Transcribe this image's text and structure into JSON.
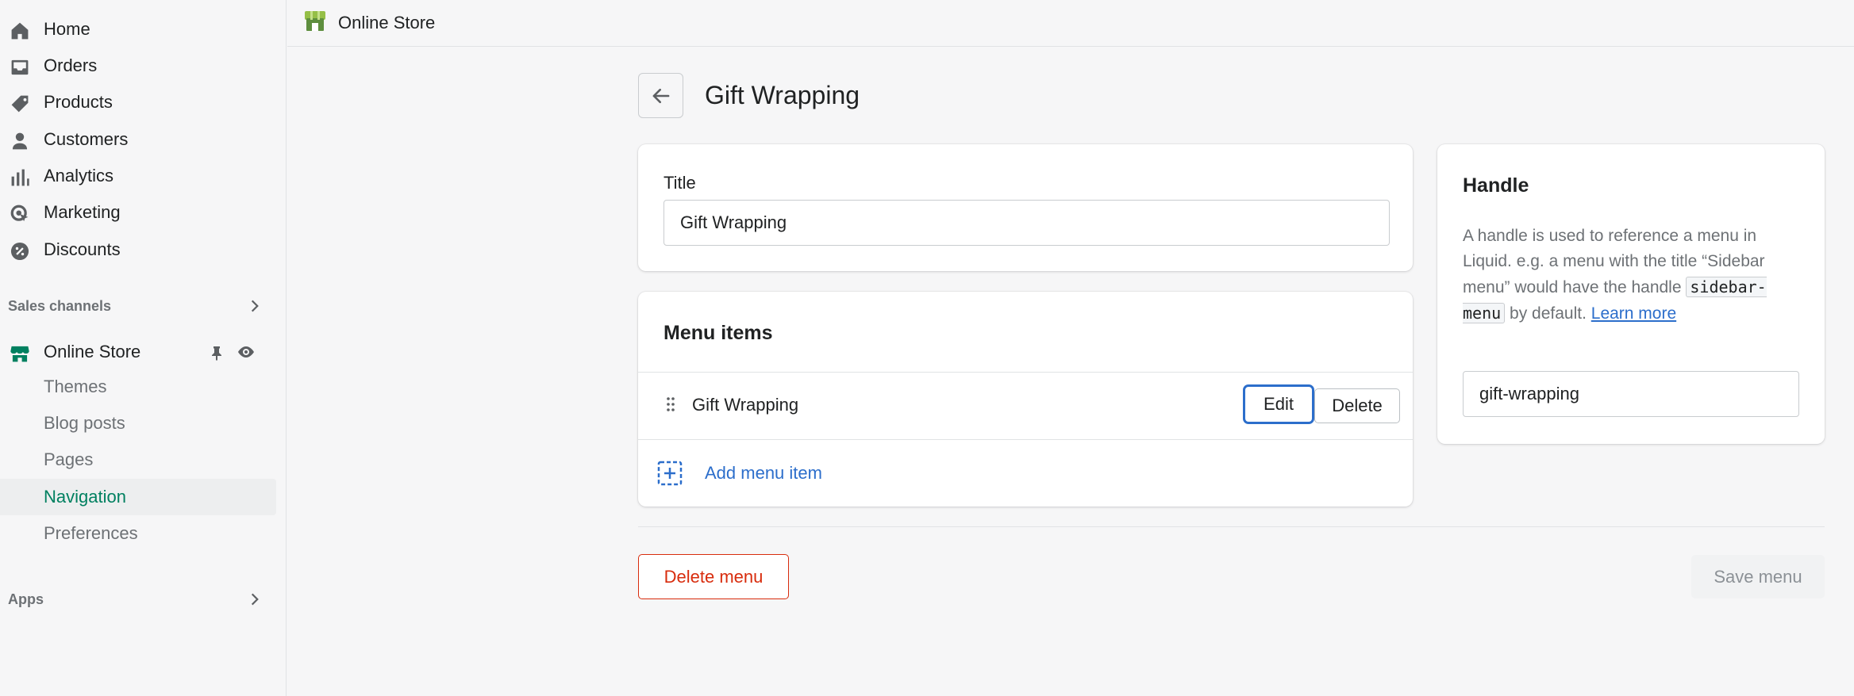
{
  "sidebar": {
    "items": [
      {
        "label": "Home",
        "icon": "home-icon"
      },
      {
        "label": "Orders",
        "icon": "orders-icon"
      },
      {
        "label": "Products",
        "icon": "tag-icon"
      },
      {
        "label": "Customers",
        "icon": "person-icon"
      },
      {
        "label": "Analytics",
        "icon": "bar-chart-icon"
      },
      {
        "label": "Marketing",
        "icon": "target-icon"
      },
      {
        "label": "Discounts",
        "icon": "discount-icon"
      }
    ],
    "sales_channels_label": "Sales channels",
    "online_store": {
      "label": "Online Store",
      "sub_items": [
        {
          "label": "Themes"
        },
        {
          "label": "Blog posts"
        },
        {
          "label": "Pages"
        },
        {
          "label": "Navigation",
          "active": true
        },
        {
          "label": "Preferences"
        }
      ]
    },
    "apps_label": "Apps"
  },
  "topbar": {
    "title": "Online Store"
  },
  "page": {
    "title": "Gift Wrapping"
  },
  "title_card": {
    "label": "Title",
    "value": "Gift Wrapping"
  },
  "menu_card": {
    "heading": "Menu items",
    "items": [
      {
        "label": "Gift Wrapping",
        "edit_label": "Edit",
        "delete_label": "Delete"
      }
    ],
    "add_label": "Add menu item"
  },
  "handle_card": {
    "heading": "Handle",
    "help_prefix": "A handle is used to reference a menu in Liquid. e.g. a menu with the title “Sidebar menu” would have the handle",
    "help_code": "sidebar-menu",
    "help_suffix": "by default.",
    "learn_more": "Learn more",
    "value": "gift-wrapping"
  },
  "footer": {
    "delete_label": "Delete menu",
    "save_label": "Save menu"
  },
  "colors": {
    "accent_green": "#008060",
    "link_blue": "#2c6ecb",
    "critical_red": "#d82c0d"
  }
}
